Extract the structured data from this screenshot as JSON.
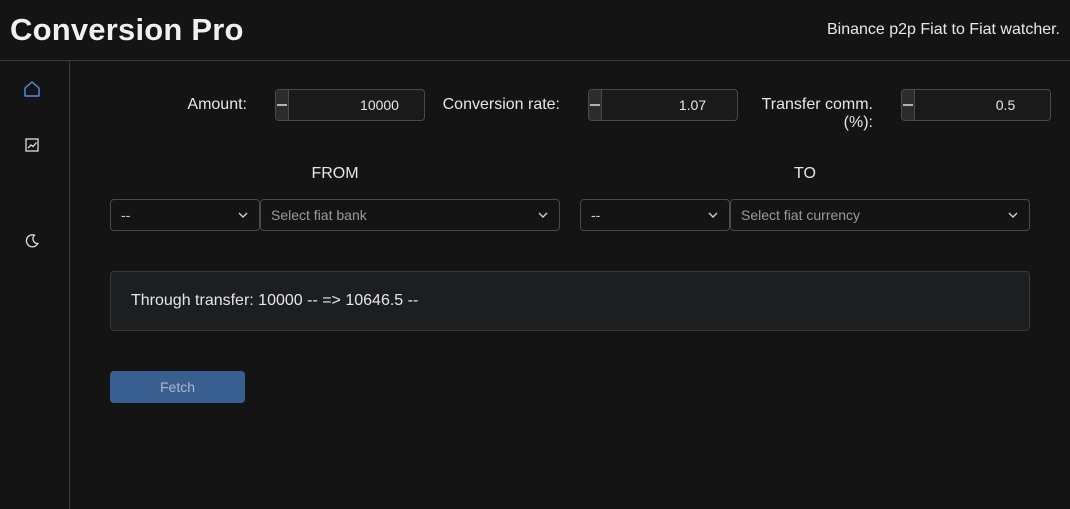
{
  "header": {
    "title": "Conversion Pro",
    "subtitle": "Binance p2p Fiat to Fiat watcher."
  },
  "sidebar": {
    "items": [
      {
        "icon": "home-icon",
        "active": true
      },
      {
        "icon": "chart-icon",
        "active": false
      },
      {
        "icon": "moon-icon",
        "active": false
      }
    ]
  },
  "inputs": {
    "amount": {
      "label": "Amount:",
      "value": "10000"
    },
    "rate": {
      "label": "Conversion rate:",
      "value": "1.07"
    },
    "commission": {
      "label_line1": "Transfer comm.",
      "label_line2": "(%):",
      "value": "0.5"
    }
  },
  "from": {
    "heading": "FROM",
    "currency_value": "--",
    "bank_placeholder": "Select fiat bank"
  },
  "to": {
    "heading": "TO",
    "currency_value": "--",
    "fiat_placeholder": "Select fiat currency"
  },
  "result": {
    "text": "Through transfer: 10000 -- => 10646.5 --"
  },
  "actions": {
    "fetch_label": "Fetch"
  },
  "colors": {
    "background": "#141414",
    "accent": "#5b8ddb",
    "button": "#395f91"
  }
}
